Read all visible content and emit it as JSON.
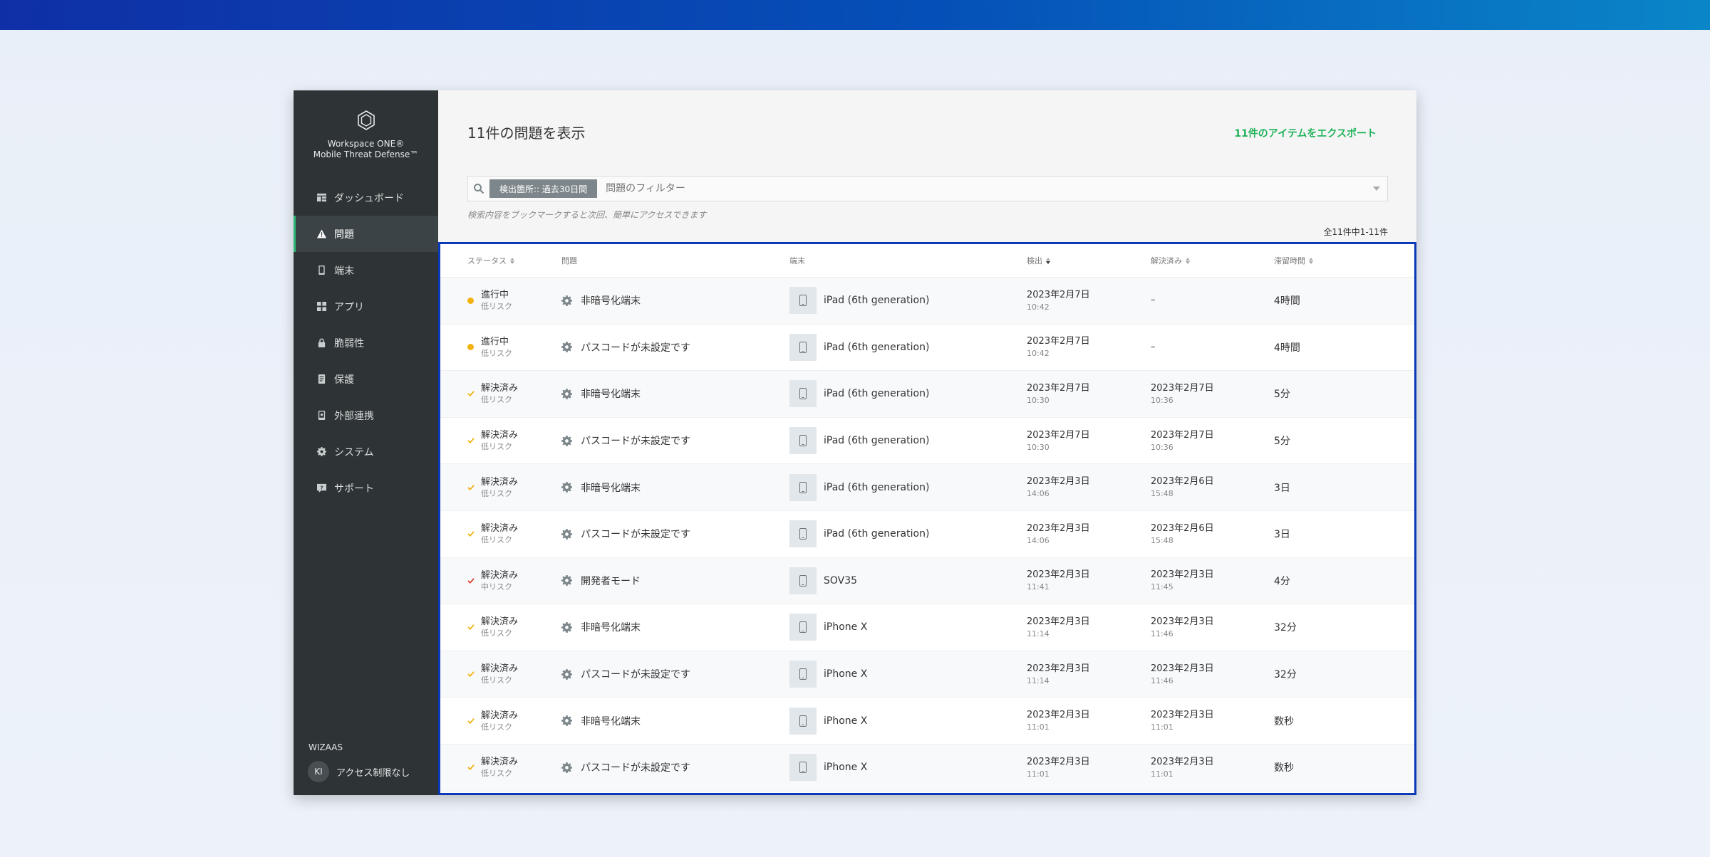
{
  "app": {
    "logo_line1": "Workspace ONE®",
    "logo_line2": "Mobile Threat Defense™"
  },
  "sidebar": {
    "items": [
      {
        "label": "ダッシュボード",
        "icon": "dashboard-icon"
      },
      {
        "label": "問題",
        "icon": "warning-icon",
        "active": true
      },
      {
        "label": "端末",
        "icon": "device-icon"
      },
      {
        "label": "アプリ",
        "icon": "apps-grid-icon"
      },
      {
        "label": "脆弱性",
        "icon": "lock-icon"
      },
      {
        "label": "保護",
        "icon": "shield-doc-icon"
      },
      {
        "label": "外部連携",
        "icon": "integration-icon"
      },
      {
        "label": "システム",
        "icon": "gear-icon"
      },
      {
        "label": "サポート",
        "icon": "help-icon"
      }
    ],
    "org_name": "WIZAAS",
    "user_initials": "KI",
    "user_label": "アクセス制限なし"
  },
  "header": {
    "title": "11件の問題を表示",
    "export_label": "11件のアイテムをエクスポート"
  },
  "filter": {
    "chip_label": "検出箇所:: 過去30日間",
    "placeholder": "問題のフィルター",
    "hint": "検索内容をブックマークすると次回、簡単にアクセスできます",
    "count_text": "全11件中1-11件"
  },
  "table": {
    "columns": [
      "ステータス",
      "問題",
      "端末",
      "検出",
      "解決済み",
      "滞留時間"
    ],
    "rows": [
      {
        "status": "進行中",
        "risk": "低リスク",
        "marker": "dot-yellow",
        "issue": "非暗号化端末",
        "device": "iPad (6th generation)",
        "detected_date": "2023年2月7日",
        "detected_time": "10:42",
        "resolved_date": "–",
        "resolved_time": "",
        "dwell": "4時間"
      },
      {
        "status": "進行中",
        "risk": "低リスク",
        "marker": "dot-yellow",
        "issue": "パスコードが未設定です",
        "device": "iPad (6th generation)",
        "detected_date": "2023年2月7日",
        "detected_time": "10:42",
        "resolved_date": "–",
        "resolved_time": "",
        "dwell": "4時間"
      },
      {
        "status": "解決済み",
        "risk": "低リスク",
        "marker": "check-yellow",
        "issue": "非暗号化端末",
        "device": "iPad (6th generation)",
        "detected_date": "2023年2月7日",
        "detected_time": "10:30",
        "resolved_date": "2023年2月7日",
        "resolved_time": "10:36",
        "dwell": "5分"
      },
      {
        "status": "解決済み",
        "risk": "低リスク",
        "marker": "check-yellow",
        "issue": "パスコードが未設定です",
        "device": "iPad (6th generation)",
        "detected_date": "2023年2月7日",
        "detected_time": "10:30",
        "resolved_date": "2023年2月7日",
        "resolved_time": "10:36",
        "dwell": "5分"
      },
      {
        "status": "解決済み",
        "risk": "低リスク",
        "marker": "check-yellow",
        "issue": "非暗号化端末",
        "device": "iPad (6th generation)",
        "detected_date": "2023年2月3日",
        "detected_time": "14:06",
        "resolved_date": "2023年2月6日",
        "resolved_time": "15:48",
        "dwell": "3日"
      },
      {
        "status": "解決済み",
        "risk": "低リスク",
        "marker": "check-yellow",
        "issue": "パスコードが未設定です",
        "device": "iPad (6th generation)",
        "detected_date": "2023年2月3日",
        "detected_time": "14:06",
        "resolved_date": "2023年2月6日",
        "resolved_time": "15:48",
        "dwell": "3日"
      },
      {
        "status": "解決済み",
        "risk": "中リスク",
        "marker": "check-red",
        "issue": "開発者モード",
        "device": "SOV35",
        "detected_date": "2023年2月3日",
        "detected_time": "11:41",
        "resolved_date": "2023年2月3日",
        "resolved_time": "11:45",
        "dwell": "4分"
      },
      {
        "status": "解決済み",
        "risk": "低リスク",
        "marker": "check-yellow",
        "issue": "非暗号化端末",
        "device": "iPhone X",
        "detected_date": "2023年2月3日",
        "detected_time": "11:14",
        "resolved_date": "2023年2月3日",
        "resolved_time": "11:46",
        "dwell": "32分"
      },
      {
        "status": "解決済み",
        "risk": "低リスク",
        "marker": "check-yellow",
        "issue": "パスコードが未設定です",
        "device": "iPhone X",
        "detected_date": "2023年2月3日",
        "detected_time": "11:14",
        "resolved_date": "2023年2月3日",
        "resolved_time": "11:46",
        "dwell": "32分"
      },
      {
        "status": "解決済み",
        "risk": "低リスク",
        "marker": "check-yellow",
        "issue": "非暗号化端末",
        "device": "iPhone X",
        "detected_date": "2023年2月3日",
        "detected_time": "11:01",
        "resolved_date": "2023年2月3日",
        "resolved_time": "11:01",
        "dwell": "数秒"
      },
      {
        "status": "解決済み",
        "risk": "低リスク",
        "marker": "check-yellow",
        "issue": "パスコードが未設定です",
        "device": "iPhone X",
        "detected_date": "2023年2月3日",
        "detected_time": "11:01",
        "resolved_date": "2023年2月3日",
        "resolved_time": "11:01",
        "dwell": "数秒"
      }
    ]
  },
  "colors": {
    "accent_green": "#20b35a",
    "status_yellow": "#f2b20d",
    "status_red": "#d9412f",
    "highlight_border": "#0a3ab8",
    "sidebar_bg": "#2e3335"
  }
}
